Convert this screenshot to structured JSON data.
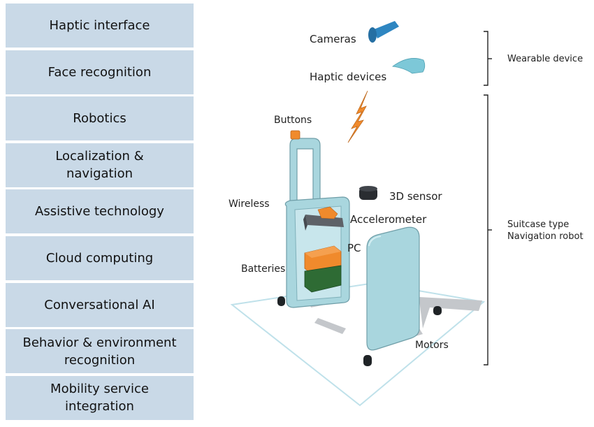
{
  "technology_stack": [
    {
      "label": "Haptic interface"
    },
    {
      "label": "Face recognition"
    },
    {
      "label": "Robotics"
    },
    {
      "label": "Localization & navigation"
    },
    {
      "label": "Assistive technology"
    },
    {
      "label": "Cloud computing"
    },
    {
      "label": "Conversational AI"
    },
    {
      "label": "Behavior & environment recognition"
    },
    {
      "label": "Mobility service integration"
    }
  ],
  "components": {
    "cameras": "Cameras",
    "haptic_devices": "Haptic devices",
    "buttons": "Buttons",
    "wireless": "Wireless",
    "sensor_3d": "3D sensor",
    "accelerometer": "Accelerometer",
    "pc": "PC",
    "batteries": "Batteries",
    "motors": "Motors"
  },
  "groups": {
    "wearable": "Wearable device",
    "robot_line1": "Suitcase type",
    "robot_line2": "Navigation robot"
  },
  "colors": {
    "stack_box": "#c9d9e7",
    "suitcase": "#a9d6de",
    "camera": "#2e86c1",
    "orange": "#f08a2c",
    "battery_green": "#2e6b34",
    "sensor_dark": "#2a2d31",
    "shadow": "#b9bcc0"
  }
}
